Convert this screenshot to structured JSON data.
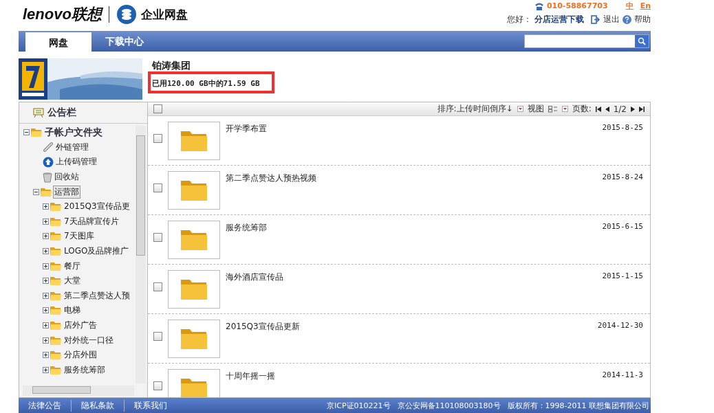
{
  "header": {
    "brand": "lenovo联想",
    "product": "企业网盘",
    "phone": "010-58867703",
    "languages": [
      {
        "label": "中"
      },
      {
        "label": "En"
      }
    ],
    "greeting": "您好：",
    "user": "分店运营下载",
    "logout": "退出",
    "help": "帮助"
  },
  "tabs": [
    {
      "label": "网盘",
      "selected": true
    },
    {
      "label": "下载中心",
      "selected": false
    }
  ],
  "company": "铂涛集团",
  "usage": "已用120.00 GB中的71.59 GB",
  "sidebar": {
    "notice": "公告栏",
    "tree": [
      {
        "label": "子帐户文件夹",
        "kind": "folder",
        "expanded": true,
        "selected": false,
        "children": [
          {
            "label": "外链管理",
            "kind": "link",
            "selected": false
          },
          {
            "label": "上传码管理",
            "kind": "upload",
            "selected": false
          },
          {
            "label": "回收站",
            "kind": "trash",
            "selected": false
          },
          {
            "label": "运营部",
            "kind": "folder",
            "expanded": true,
            "selected": true,
            "children": [
              {
                "label": "2015Q3宣传品更",
                "kind": "folder",
                "expanded": false,
                "selected": false
              },
              {
                "label": "7天品牌宣传片",
                "kind": "folder",
                "expanded": false,
                "selected": false
              },
              {
                "label": "7天图库",
                "kind": "folder",
                "expanded": false,
                "selected": false
              },
              {
                "label": "LOGO及品牌推广",
                "kind": "folder",
                "expanded": false,
                "selected": false
              },
              {
                "label": "餐厅",
                "kind": "folder",
                "expanded": false,
                "selected": false
              },
              {
                "label": "大堂",
                "kind": "folder",
                "expanded": false,
                "selected": false
              },
              {
                "label": "第二季点赞达人预",
                "kind": "folder",
                "expanded": false,
                "selected": false
              },
              {
                "label": "电梯",
                "kind": "folder",
                "expanded": false,
                "selected": false
              },
              {
                "label": "店外广告",
                "kind": "folder",
                "expanded": false,
                "selected": false
              },
              {
                "label": "对外统一口径",
                "kind": "folder",
                "expanded": false,
                "selected": false
              },
              {
                "label": "分店外围",
                "kind": "folder",
                "expanded": false,
                "selected": false
              },
              {
                "label": "服务统筹部",
                "kind": "folder",
                "expanded": false,
                "selected": false
              }
            ]
          }
        ]
      }
    ]
  },
  "toolbar": {
    "select_all": false,
    "sort": "排序:上传时间倒序↓",
    "view": "视图",
    "pages_label": "页数:",
    "page": "1/2"
  },
  "files": [
    {
      "name": "开学季布置",
      "date": "2015-8-25",
      "checked": false
    },
    {
      "name": "第二季点赞达人预热视频",
      "date": "2015-8-24",
      "checked": false
    },
    {
      "name": "服务统筹部",
      "date": "2015-6-15",
      "checked": false
    },
    {
      "name": "海外酒店宣传品",
      "date": "2015-1-15",
      "checked": false
    },
    {
      "name": "2015Q3宣传品更新",
      "date": "2014-12-30",
      "checked": false
    },
    {
      "name": "十周年摇一摇",
      "date": "2014-11-3",
      "checked": false
    }
  ],
  "footer": {
    "links": [
      "法律公告",
      "隐私条款",
      "联系我们"
    ],
    "info": [
      "京ICP证010221号",
      "京公安网备110108003180号",
      "版权所有：1998-2011 联想集团有限公司"
    ]
  }
}
